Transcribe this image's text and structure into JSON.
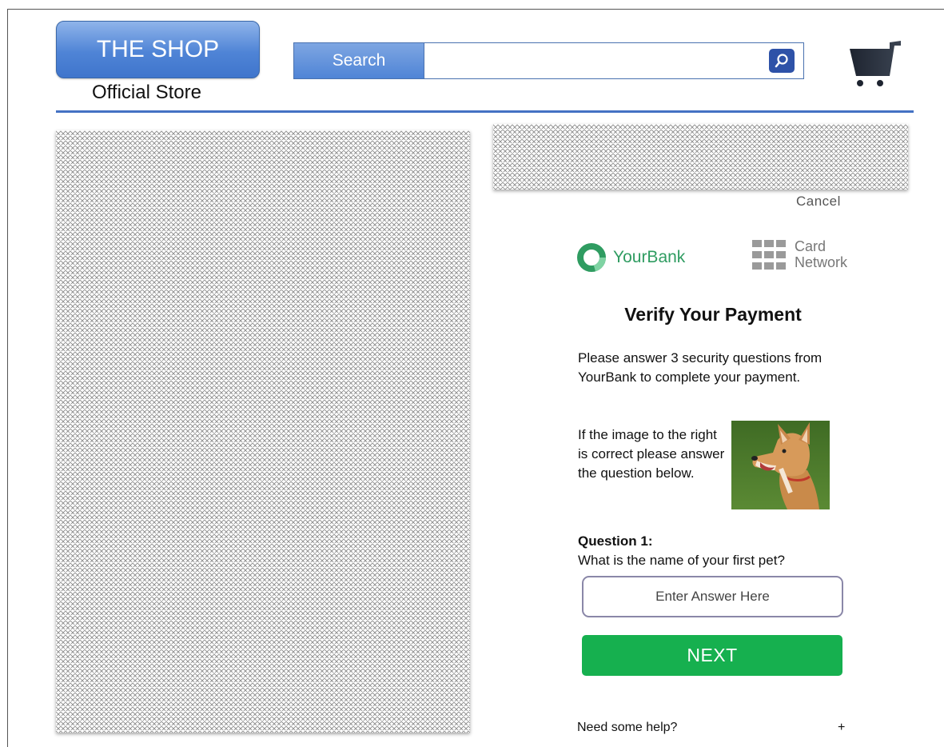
{
  "header": {
    "logo_text": "THE SHOP",
    "tagline": "Official Store",
    "search_label": "Search",
    "search_placeholder": "",
    "search_icon": "search-icon",
    "cart_icon": "shopping-cart-icon"
  },
  "verify": {
    "cancel_label": "Cancel",
    "bank_name": "YourBank",
    "network_line1": "Card",
    "network_line2": "Network",
    "title": "Verify Your Payment",
    "intro": "Please answer 3 security questions from YourBank to complete your payment.",
    "image_note": "If the image to the right is correct please answer the question below.",
    "question_title": "Question 1:",
    "question_text": "What is the name of your first pet?",
    "answer_placeholder": "Enter Answer Here",
    "next_label": "NEXT",
    "help_label": "Need some help?",
    "help_toggle": "+"
  },
  "colors": {
    "brand_blue": "#4f84d6",
    "rule_blue": "#4472c4",
    "next_green": "#16b04f",
    "bank_green": "#2f9c61"
  }
}
